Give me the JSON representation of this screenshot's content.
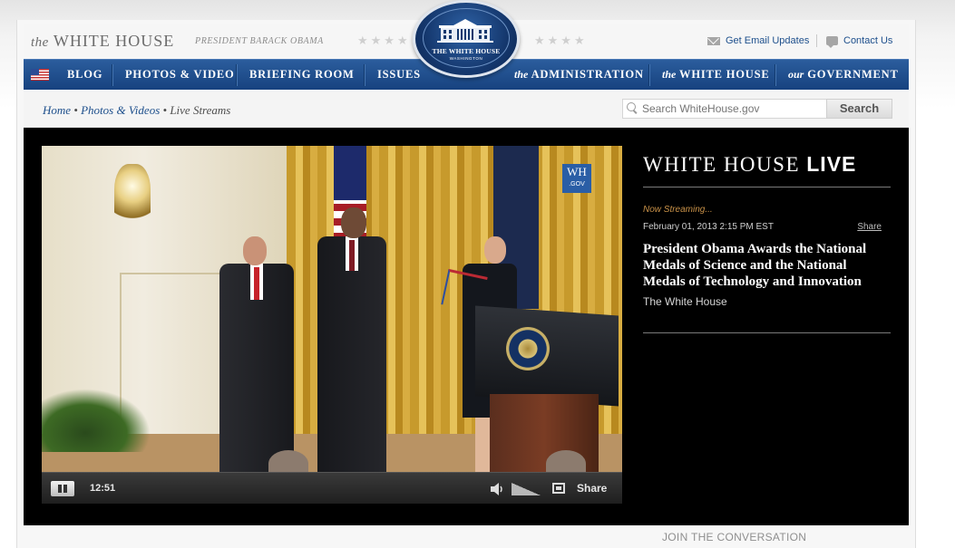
{
  "header": {
    "brand_the": "the",
    "brand_name": "WHITE HOUSE",
    "president": "PRESIDENT BARACK OBAMA",
    "email_link": "Get Email Updates",
    "contact_link": "Contact Us",
    "seal_title": "THE WHITE HOUSE",
    "seal_sub": "WASHINGTON",
    "stars": "★★★★"
  },
  "nav": {
    "items": [
      "BLOG",
      "PHOTOS & VIDEO",
      "BRIEFING ROOM",
      "ISSUES"
    ],
    "right": [
      {
        "prefix": "the",
        "label": "ADMINISTRATION"
      },
      {
        "prefix": "the",
        "label": "WHITE HOUSE"
      },
      {
        "prefix": "our",
        "label": "GOVERNMENT"
      }
    ]
  },
  "breadcrumb": {
    "home": "Home",
    "sep": "•",
    "photos": "Photos & Videos",
    "current": "Live Streams"
  },
  "search": {
    "placeholder": "Search WhiteHouse.gov",
    "button": "Search"
  },
  "live": {
    "title_light": "WHITE HOUSE ",
    "title_bold": "LIVE",
    "now_streaming": "Now Streaming...",
    "date": "February 01, 2013 2:15 PM EST",
    "share": "Share",
    "event_title": "President Obama Awards the National Medals of Science and the National Medals of Technology and Innovation",
    "event_source": "The White House"
  },
  "player": {
    "watermark": "WH",
    "watermark_sub": ".GOV",
    "time": "12:51",
    "share": "Share"
  },
  "footer": {
    "join": "JOIN THE CONVERSATION"
  },
  "colors": {
    "nav": "#1f4d8c",
    "link": "#1d4f8c",
    "accent_streaming": "#c89148",
    "panel": "#000000"
  },
  "icons": [
    "flag-icon",
    "envelope-icon",
    "speech-bubble-icon",
    "search-icon",
    "pause-icon",
    "volume-icon",
    "fullscreen-icon"
  ]
}
